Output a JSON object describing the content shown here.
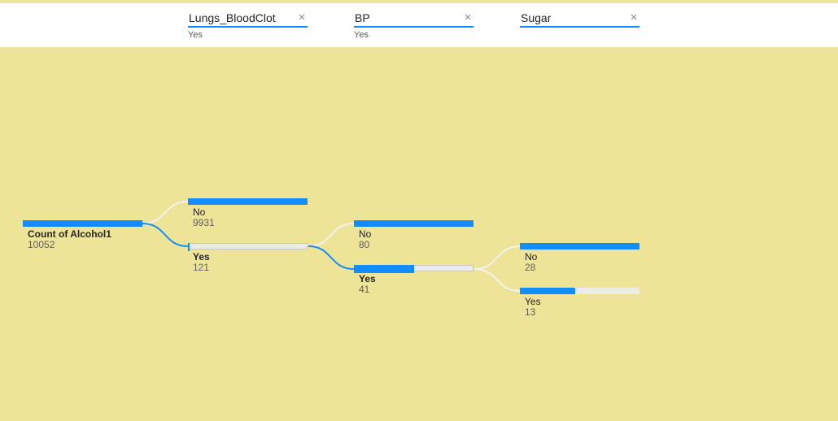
{
  "colors": {
    "accent": "#118DFF",
    "background": "#EEE498",
    "track": "#EDEBE9",
    "connector": "#F3F2F1"
  },
  "filters": [
    {
      "name": "Lungs_BloodClot",
      "value": "Yes",
      "icon": "close-icon",
      "glyph": "×"
    },
    {
      "name": "BP",
      "value": "Yes",
      "icon": "close-icon",
      "glyph": "×"
    },
    {
      "name": "Sugar",
      "value": "",
      "icon": "close-icon",
      "glyph": "×"
    }
  ],
  "tree": {
    "root": {
      "label": "Count of Alcohol1",
      "value": "10052",
      "share": 1.0
    },
    "level1": [
      {
        "label": "No",
        "value": "9931",
        "share": 1.0
      },
      {
        "label": "Yes",
        "value": "121",
        "share": 0.012
      }
    ],
    "level2": [
      {
        "label": "No",
        "value": "80",
        "share": 1.0
      },
      {
        "label": "Yes",
        "value": "41",
        "share": 0.51
      }
    ],
    "level3": [
      {
        "label": "No",
        "value": "28",
        "share": 1.0
      },
      {
        "label": "Yes",
        "value": "13",
        "share": 0.46
      }
    ]
  }
}
